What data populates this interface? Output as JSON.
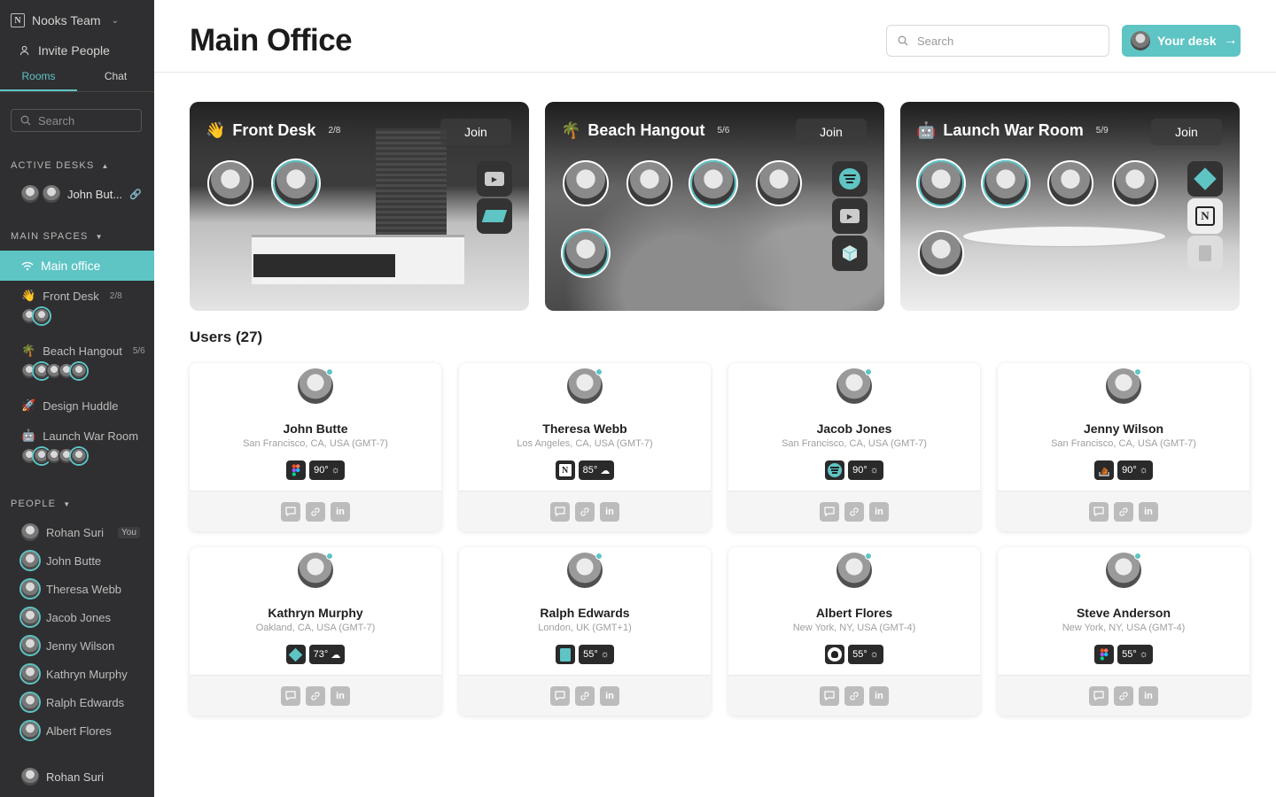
{
  "sidebar": {
    "team": "Nooks Team",
    "invite": "Invite People",
    "tabs": [
      "Rooms",
      "Chat"
    ],
    "search_placeholder": "Search",
    "active_desks_header": "ACTIVE DESKS",
    "active_desk_name": "John But...",
    "main_spaces_header": "MAIN SPACES",
    "spaces": [
      {
        "name": "Main office"
      },
      {
        "name": "Front Desk",
        "count": "2/8"
      },
      {
        "name": "Beach Hangout",
        "count": "5/6"
      },
      {
        "name": "Design Huddle"
      },
      {
        "name": "Launch War Room"
      }
    ],
    "people_header": "PEOPLE",
    "people": [
      "Rohan Suri",
      "John Butte",
      "Theresa Webb",
      "Jacob Jones",
      "Jenny Wilson",
      "Kathryn Murphy",
      "Ralph Edwards",
      "Albert Flores"
    ],
    "you_badge": "You",
    "current_user": "Rohan Suri"
  },
  "header": {
    "title": "Main Office",
    "search_placeholder": "Search",
    "your_desk": "Your desk"
  },
  "rooms": [
    {
      "name": "Front Desk",
      "capacity": "2/8",
      "join": "Join"
    },
    {
      "name": "Beach Hangout",
      "capacity": "5/6",
      "join": "Join"
    },
    {
      "name": "Launch War Room",
      "capacity": "5/9",
      "join": "Join"
    }
  ],
  "users_title": "Users (27)",
  "users": [
    {
      "name": "John Butte",
      "location": "San Francisco, CA, USA (GMT-7)",
      "app_icon": "figma-icon",
      "weather": "90°",
      "weather_icon": "sun-icon"
    },
    {
      "name": "Theresa Webb",
      "location": "Los Angeles, CA, USA (GMT-7)",
      "app_icon": "notion-icon",
      "weather": "85°",
      "weather_icon": "cloud-icon"
    },
    {
      "name": "Jacob Jones",
      "location": "San Francisco, CA, USA (GMT-7)",
      "app_icon": "spotify-icon",
      "weather": "90°",
      "weather_icon": "sun-icon"
    },
    {
      "name": "Jenny Wilson",
      "location": "San Francisco, CA, USA (GMT-7)",
      "app_icon": "stack-overflow-icon",
      "weather": "90°",
      "weather_icon": "sun-icon"
    },
    {
      "name": "Kathryn Murphy",
      "location": "Oakland, CA, USA (GMT-7)",
      "app_icon": "diamond-app-icon",
      "weather": "73°",
      "weather_icon": "cloud-icon"
    },
    {
      "name": "Ralph Edwards",
      "location": "London, UK (GMT+1)",
      "app_icon": "google-docs-icon",
      "weather": "55°",
      "weather_icon": "sun-icon"
    },
    {
      "name": "Albert Flores",
      "location": "New York, NY, USA (GMT-4)",
      "app_icon": "github-icon",
      "weather": "55°",
      "weather_icon": "sun-icon"
    },
    {
      "name": "Steve Anderson",
      "location": "New York, NY, USA (GMT-4)",
      "app_icon": "figma-icon",
      "weather": "55°",
      "weather_icon": "sun-icon"
    }
  ],
  "colors": {
    "accent": "#5ec4c4",
    "sidebar": "#2f2f31"
  }
}
